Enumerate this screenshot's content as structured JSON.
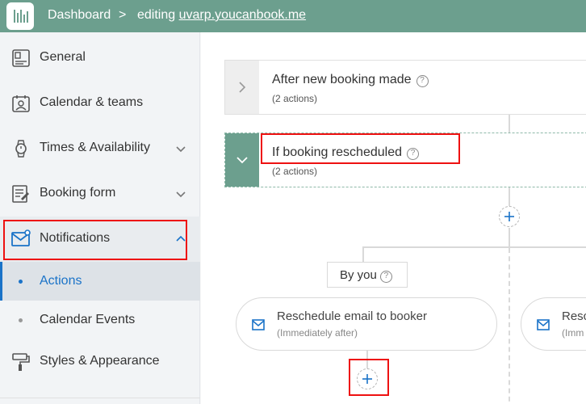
{
  "header": {
    "dashboard": "Dashboard",
    "separator": ">",
    "editing_prefix": "editing",
    "site": "uvarp.youcanbook.me"
  },
  "sidebar": {
    "items": [
      {
        "label": "General",
        "icon": "id-card-icon"
      },
      {
        "label": "Calendar & teams",
        "icon": "calendar-person-icon"
      },
      {
        "label": "Times & Availability",
        "icon": "watch-icon",
        "expanded": false
      },
      {
        "label": "Booking form",
        "icon": "form-edit-icon",
        "expanded": false
      },
      {
        "label": "Notifications",
        "icon": "mail-notification-icon",
        "expanded": true
      },
      {
        "label": "Styles & Appearance",
        "icon": "paint-roller-icon"
      }
    ],
    "notifications_sub": [
      {
        "label": "Actions",
        "active": true
      },
      {
        "label": "Calendar Events",
        "active": false
      }
    ]
  },
  "main": {
    "triggers": [
      {
        "title": "After new booking made",
        "subtitle": "(2 actions)",
        "open": false
      },
      {
        "title": "If booking rescheduled",
        "subtitle": "(2 actions)",
        "open": true
      }
    ],
    "branch_label": "By you",
    "actions": [
      {
        "title": "Reschedule email to booker",
        "subtitle": "(Immediately after)"
      },
      {
        "title": "Resc",
        "subtitle": "(Imm"
      }
    ]
  },
  "colors": {
    "header_bg": "#6c9f8e",
    "accent_blue": "#1a73c8",
    "highlight_red": "#ee1111"
  }
}
